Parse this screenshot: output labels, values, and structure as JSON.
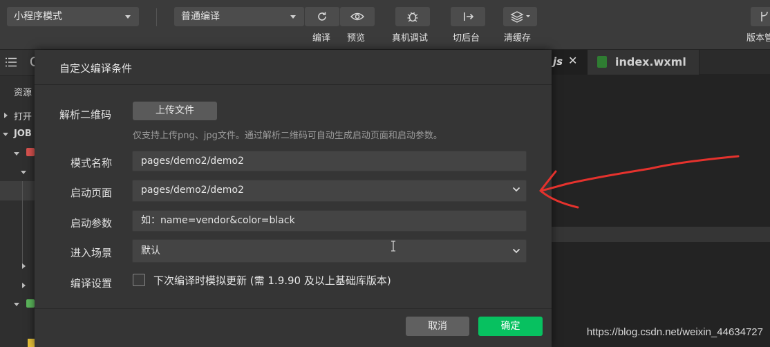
{
  "toolbar": {
    "mode_dropdown": "小程序模式",
    "compile_dropdown": "普通编译",
    "buttons": {
      "compile": "编译",
      "preview": "预览",
      "real_debug": "真机调试",
      "background": "切后台",
      "clear_cache": "清缓存",
      "version": "版本管"
    }
  },
  "sidebar": {
    "resources": "资源",
    "open": "打开",
    "project": "JOB"
  },
  "editor": {
    "active_tab": "js",
    "tab2": "index.wxml",
    "bottom_text": "}"
  },
  "dialog": {
    "title": "自定义编译条件",
    "qr_label": "解析二维码",
    "upload_button": "上传文件",
    "qr_hint": "仅支持上传png、jpg文件。通过解析二维码可自动生成启动页面和启动参数。",
    "mode_name_label": "模式名称",
    "mode_name_value": "pages/demo2/demo2",
    "start_page_label": "启动页面",
    "start_page_value": "pages/demo2/demo2",
    "start_params_label": "启动参数",
    "start_params_placeholder": "如：name=vendor&color=black",
    "scene_label": "进入场景",
    "scene_value": "默认",
    "compile_settings_label": "编译设置",
    "compile_checkbox_label": "下次编译时模拟更新 (需 1.9.90 及以上基础库版本)",
    "cancel": "取消",
    "confirm": "确定"
  },
  "watermark": "https://blog.csdn.net/weixin_44634727",
  "colors": {
    "accent_green": "#07c160",
    "annotation_red": "#e5322d"
  }
}
